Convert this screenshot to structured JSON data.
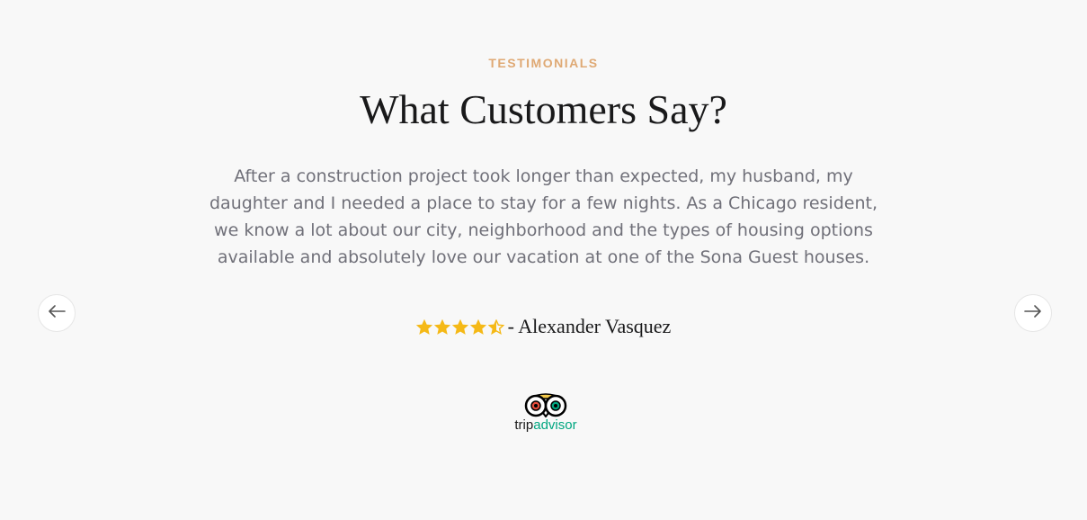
{
  "section": {
    "eyebrow": "TESTIMONIALS",
    "title": "What Customers Say?"
  },
  "testimonial": {
    "quote": "After a construction project took longer than expected, my husband, my daughter and I needed a place to stay for a few nights. As a Chicago resident, we know a lot about our city, neighborhood and the types of housing options available and absolutely love our vacation at one of the Sona Guest houses.",
    "rating": 4.5,
    "rating_max": 5,
    "author": "- Alexander Vasquez"
  },
  "brand": {
    "logo_text_part1": "trip",
    "logo_text_part2": "advisor"
  },
  "nav": {
    "prev_icon": "arrow-left-icon",
    "next_icon": "arrow-right-icon"
  },
  "colors": {
    "accent": "#dfa974",
    "star": "#f5b917",
    "tripadvisor_green": "#00a680"
  }
}
